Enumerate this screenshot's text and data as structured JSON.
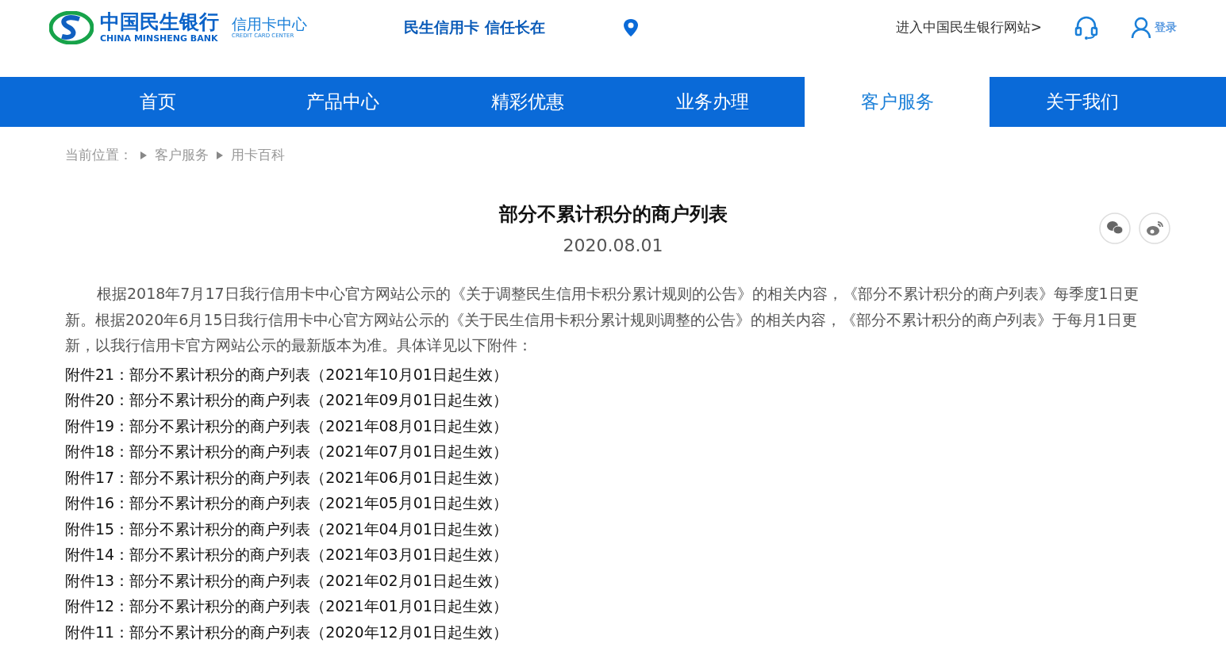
{
  "header": {
    "logo_cn": "中国民生银行",
    "logo_en": "CHINA MINSHENG BANK",
    "sub_cn": "信用卡中心",
    "sub_en": "CREDIT CARD CENTER",
    "slogan": "民生信用卡 信任长在",
    "bank_link": "进入中国民生银行网站>",
    "login": "登录"
  },
  "nav": [
    {
      "label": "首页",
      "selected": false
    },
    {
      "label": "产品中心",
      "selected": false
    },
    {
      "label": "精彩优惠",
      "selected": false
    },
    {
      "label": "业务办理",
      "selected": false
    },
    {
      "label": "客户服务",
      "selected": true
    },
    {
      "label": "关于我们",
      "selected": false
    }
  ],
  "breadcrumb": [
    "当前位置：",
    "客户服务",
    "用卡百科"
  ],
  "article": {
    "title": "部分不累计积分的商户列表",
    "date": "2020.08.01",
    "intro": "根据2018年7月17日我行信用卡中心官方网站公示的《关于调整民生信用卡积分累计规则的公告》的相关内容，《部分不累计积分的商户列表》每季度1日更新。根据2020年6月15日我行信用卡中心官方网站公示的《关于民生信用卡积分累计规则调整的公告》的相关内容，《部分不累计积分的商户列表》于每月1日更新，以我行信用卡官方网站公示的最新版本为准。具体详见以下附件：",
    "attachments": [
      "附件21：部分不累计积分的商户列表（2021年10月01日起生效）",
      "附件20：部分不累计积分的商户列表（2021年09月01日起生效）",
      "附件19：部分不累计积分的商户列表（2021年08月01日起生效）",
      "附件18：部分不累计积分的商户列表（2021年07月01日起生效）",
      "附件17：部分不累计积分的商户列表（2021年06月01日起生效）",
      "附件16：部分不累计积分的商户列表（2021年05月01日起生效）",
      "附件15：部分不累计积分的商户列表（2021年04月01日起生效）",
      "附件14：部分不累计积分的商户列表（2021年03月01日起生效）",
      "附件13：部分不累计积分的商户列表（2021年02月01日起生效）",
      "附件12：部分不累计积分的商户列表（2021年01月01日起生效）",
      "附件11：部分不累计积分的商户列表（2020年12月01日起生效）"
    ]
  }
}
